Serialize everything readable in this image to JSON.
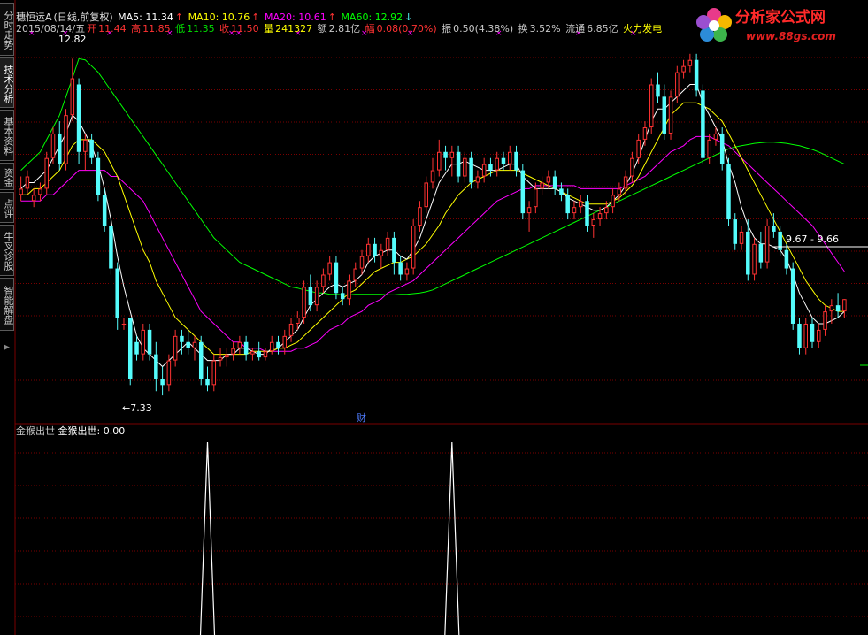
{
  "sidebar": {
    "tabs": [
      {
        "label": "分时走势",
        "active": false
      },
      {
        "label": "技术分析",
        "active": true
      },
      {
        "label": "基本资料",
        "active": false
      },
      {
        "label": "资金",
        "active": false
      },
      {
        "label": "点评",
        "active": false
      },
      {
        "label": "牛叉诊股",
        "active": false
      },
      {
        "label": "智能解盘",
        "active": false
      }
    ]
  },
  "header": {
    "name": "穗恒运A",
    "mode": "(日线,前复权)",
    "ma5_label": "MA5: 11.34",
    "ma5_arrow": "↑",
    "ma10_label": "MA10: 10.76",
    "ma10_arrow": "↑",
    "ma20_label": "MA20: 10.61",
    "ma20_arrow": "↑",
    "ma60_label": "MA60: 12.92",
    "ma60_arrow": "↓"
  },
  "quote": {
    "date": "2015/08/14/五",
    "open_label": "开",
    "open": "11.44",
    "high_label": "高",
    "high": "11.85",
    "low_label": "低",
    "low": "11.35",
    "close_label": "收",
    "close": "11.50",
    "volume_label": "量",
    "volume": "241327",
    "amount_label": "额",
    "amount": "2.81亿",
    "change_label": "幅",
    "change": "0.08(0.70%)",
    "amplitude_label": "振",
    "amplitude": "0.50(4.38%)",
    "turnover_label": "换",
    "turnover": "3.52%",
    "float_label": "流通",
    "float_value": "6.85亿",
    "signal": "火力发电"
  },
  "logo": {
    "title": "分析家公式网",
    "url": "www.88gs.com"
  },
  "annotations": {
    "high_mark": "12.82",
    "low_mark": "←7.33",
    "range_mark": "9.67 - 9.66",
    "event_badge": "财"
  },
  "indicator": {
    "name": "金猴出世",
    "label": "金猴出世:",
    "value": "0.00"
  },
  "colors": {
    "up": "#ff3232",
    "down": "#54fcfc",
    "ma5": "#ffffff",
    "ma10": "#ffff00",
    "ma20": "#ff00ff",
    "ma60": "#00ff00",
    "grid": "#7a0000"
  },
  "chart_data": {
    "type": "candlestick",
    "price_range": [
      7.0,
      13.2
    ],
    "candles": [
      {
        "o": 10.6,
        "h": 10.9,
        "l": 10.5,
        "c": 10.7
      },
      {
        "o": 10.7,
        "h": 11.0,
        "l": 10.6,
        "c": 10.9
      },
      {
        "o": 10.5,
        "h": 10.7,
        "l": 10.4,
        "c": 10.6
      },
      {
        "o": 10.6,
        "h": 10.8,
        "l": 10.5,
        "c": 10.7
      },
      {
        "o": 10.7,
        "h": 11.3,
        "l": 10.6,
        "c": 11.2
      },
      {
        "o": 11.2,
        "h": 11.7,
        "l": 11.1,
        "c": 11.6
      },
      {
        "o": 11.6,
        "h": 11.8,
        "l": 11.0,
        "c": 11.1
      },
      {
        "o": 11.1,
        "h": 12.0,
        "l": 11.0,
        "c": 11.9
      },
      {
        "o": 11.9,
        "h": 12.82,
        "l": 11.8,
        "c": 12.5
      },
      {
        "o": 12.4,
        "h": 12.5,
        "l": 11.1,
        "c": 11.3
      },
      {
        "o": 11.3,
        "h": 11.6,
        "l": 11.0,
        "c": 11.5
      },
      {
        "o": 11.5,
        "h": 11.6,
        "l": 11.1,
        "c": 11.2
      },
      {
        "o": 11.2,
        "h": 11.3,
        "l": 10.5,
        "c": 10.6
      },
      {
        "o": 10.6,
        "h": 10.7,
        "l": 10.0,
        "c": 10.1
      },
      {
        "o": 10.1,
        "h": 10.2,
        "l": 9.3,
        "c": 9.4
      },
      {
        "o": 9.4,
        "h": 9.5,
        "l": 8.4,
        "c": 8.6
      },
      {
        "o": 8.5,
        "h": 8.6,
        "l": 8.4,
        "c": 8.5
      },
      {
        "o": 8.6,
        "h": 8.6,
        "l": 7.5,
        "c": 7.6
      },
      {
        "o": 8.2,
        "h": 8.3,
        "l": 7.9,
        "c": 8.0
      },
      {
        "o": 8.0,
        "h": 8.5,
        "l": 7.9,
        "c": 8.4
      },
      {
        "o": 8.4,
        "h": 8.5,
        "l": 7.9,
        "c": 8.0
      },
      {
        "o": 8.0,
        "h": 8.2,
        "l": 7.4,
        "c": 7.6
      },
      {
        "o": 7.6,
        "h": 7.8,
        "l": 7.33,
        "c": 7.5
      },
      {
        "o": 7.5,
        "h": 8.0,
        "l": 7.4,
        "c": 7.9
      },
      {
        "o": 7.9,
        "h": 8.4,
        "l": 7.8,
        "c": 8.3
      },
      {
        "o": 8.3,
        "h": 8.4,
        "l": 8.0,
        "c": 8.2
      },
      {
        "o": 8.2,
        "h": 8.4,
        "l": 8.0,
        "c": 8.1
      },
      {
        "o": 8.1,
        "h": 8.3,
        "l": 7.9,
        "c": 8.2
      },
      {
        "o": 8.2,
        "h": 8.3,
        "l": 7.5,
        "c": 7.6
      },
      {
        "o": 7.6,
        "h": 7.8,
        "l": 7.4,
        "c": 7.5
      },
      {
        "o": 7.5,
        "h": 8.0,
        "l": 7.4,
        "c": 7.9
      },
      {
        "o": 7.9,
        "h": 8.1,
        "l": 7.8,
        "c": 7.95
      },
      {
        "o": 7.95,
        "h": 8.1,
        "l": 7.8,
        "c": 8.0
      },
      {
        "o": 8.0,
        "h": 8.2,
        "l": 7.9,
        "c": 8.1
      },
      {
        "o": 8.1,
        "h": 8.3,
        "l": 8.0,
        "c": 8.2
      },
      {
        "o": 8.2,
        "h": 8.3,
        "l": 7.9,
        "c": 8.0
      },
      {
        "o": 8.0,
        "h": 8.1,
        "l": 7.9,
        "c": 8.05
      },
      {
        "o": 8.05,
        "h": 8.2,
        "l": 7.9,
        "c": 7.95
      },
      {
        "o": 7.95,
        "h": 8.1,
        "l": 7.9,
        "c": 8.05
      },
      {
        "o": 8.05,
        "h": 8.3,
        "l": 8.0,
        "c": 8.2
      },
      {
        "o": 8.2,
        "h": 8.3,
        "l": 8.0,
        "c": 8.1
      },
      {
        "o": 8.1,
        "h": 8.4,
        "l": 8.0,
        "c": 8.3
      },
      {
        "o": 8.3,
        "h": 8.6,
        "l": 8.2,
        "c": 8.5
      },
      {
        "o": 8.5,
        "h": 8.7,
        "l": 8.4,
        "c": 8.6
      },
      {
        "o": 8.6,
        "h": 9.2,
        "l": 8.5,
        "c": 9.1
      },
      {
        "o": 9.1,
        "h": 9.3,
        "l": 8.7,
        "c": 8.8
      },
      {
        "o": 8.8,
        "h": 9.2,
        "l": 8.7,
        "c": 9.1
      },
      {
        "o": 9.1,
        "h": 9.4,
        "l": 9.0,
        "c": 9.3
      },
      {
        "o": 9.3,
        "h": 9.6,
        "l": 9.2,
        "c": 9.5
      },
      {
        "o": 9.5,
        "h": 9.6,
        "l": 8.9,
        "c": 9.0
      },
      {
        "o": 9.0,
        "h": 9.1,
        "l": 8.8,
        "c": 8.9
      },
      {
        "o": 8.9,
        "h": 9.3,
        "l": 8.8,
        "c": 9.2
      },
      {
        "o": 9.2,
        "h": 9.5,
        "l": 9.1,
        "c": 9.4
      },
      {
        "o": 9.4,
        "h": 9.7,
        "l": 9.3,
        "c": 9.6
      },
      {
        "o": 9.6,
        "h": 9.9,
        "l": 9.5,
        "c": 9.8
      },
      {
        "o": 9.8,
        "h": 9.9,
        "l": 9.5,
        "c": 9.6
      },
      {
        "o": 9.6,
        "h": 9.8,
        "l": 9.4,
        "c": 9.7
      },
      {
        "o": 9.7,
        "h": 10.0,
        "l": 9.6,
        "c": 9.9
      },
      {
        "o": 9.9,
        "h": 10.0,
        "l": 9.3,
        "c": 9.5
      },
      {
        "o": 9.5,
        "h": 9.6,
        "l": 9.2,
        "c": 9.3
      },
      {
        "o": 9.3,
        "h": 9.5,
        "l": 9.2,
        "c": 9.4
      },
      {
        "o": 9.4,
        "h": 10.2,
        "l": 9.3,
        "c": 10.1
      },
      {
        "o": 10.1,
        "h": 10.5,
        "l": 10.0,
        "c": 10.4
      },
      {
        "o": 10.4,
        "h": 10.9,
        "l": 10.3,
        "c": 10.8
      },
      {
        "o": 10.8,
        "h": 11.2,
        "l": 10.7,
        "c": 11.0
      },
      {
        "o": 11.0,
        "h": 11.5,
        "l": 10.9,
        "c": 11.3
      },
      {
        "o": 11.3,
        "h": 11.4,
        "l": 11.0,
        "c": 11.2
      },
      {
        "o": 11.2,
        "h": 11.4,
        "l": 10.9,
        "c": 11.3
      },
      {
        "o": 11.3,
        "h": 11.4,
        "l": 10.8,
        "c": 10.9
      },
      {
        "o": 10.9,
        "h": 11.3,
        "l": 10.8,
        "c": 11.2
      },
      {
        "o": 11.2,
        "h": 11.3,
        "l": 10.7,
        "c": 10.8
      },
      {
        "o": 10.8,
        "h": 11.0,
        "l": 10.7,
        "c": 10.9
      },
      {
        "o": 10.9,
        "h": 11.2,
        "l": 10.8,
        "c": 11.1
      },
      {
        "o": 11.1,
        "h": 11.2,
        "l": 10.9,
        "c": 11.0
      },
      {
        "o": 11.0,
        "h": 11.3,
        "l": 10.9,
        "c": 11.2
      },
      {
        "o": 11.2,
        "h": 11.3,
        "l": 11.0,
        "c": 11.1
      },
      {
        "o": 11.1,
        "h": 11.4,
        "l": 11.0,
        "c": 11.3
      },
      {
        "o": 11.3,
        "h": 11.4,
        "l": 10.9,
        "c": 11.0
      },
      {
        "o": 11.0,
        "h": 11.1,
        "l": 10.2,
        "c": 10.3
      },
      {
        "o": 10.3,
        "h": 10.5,
        "l": 10.0,
        "c": 10.4
      },
      {
        "o": 10.4,
        "h": 10.8,
        "l": 10.3,
        "c": 10.7
      },
      {
        "o": 10.7,
        "h": 10.9,
        "l": 10.6,
        "c": 10.8
      },
      {
        "o": 10.8,
        "h": 11.0,
        "l": 10.7,
        "c": 10.9
      },
      {
        "o": 10.9,
        "h": 11.0,
        "l": 10.6,
        "c": 10.7
      },
      {
        "o": 10.7,
        "h": 10.8,
        "l": 10.5,
        "c": 10.6
      },
      {
        "o": 10.6,
        "h": 10.7,
        "l": 10.2,
        "c": 10.3
      },
      {
        "o": 10.3,
        "h": 10.5,
        "l": 10.2,
        "c": 10.4
      },
      {
        "o": 10.4,
        "h": 10.6,
        "l": 10.3,
        "c": 10.5
      },
      {
        "o": 10.5,
        "h": 10.6,
        "l": 10.0,
        "c": 10.1
      },
      {
        "o": 10.1,
        "h": 10.3,
        "l": 9.9,
        "c": 10.2
      },
      {
        "o": 10.2,
        "h": 10.4,
        "l": 10.1,
        "c": 10.3
      },
      {
        "o": 10.3,
        "h": 10.5,
        "l": 10.2,
        "c": 10.4
      },
      {
        "o": 10.4,
        "h": 10.7,
        "l": 10.3,
        "c": 10.6
      },
      {
        "o": 10.6,
        "h": 10.8,
        "l": 10.5,
        "c": 10.7
      },
      {
        "o": 10.7,
        "h": 11.0,
        "l": 10.6,
        "c": 10.9
      },
      {
        "o": 10.9,
        "h": 11.3,
        "l": 10.8,
        "c": 11.2
      },
      {
        "o": 11.2,
        "h": 11.6,
        "l": 11.1,
        "c": 11.5
      },
      {
        "o": 11.5,
        "h": 11.8,
        "l": 11.4,
        "c": 11.7
      },
      {
        "o": 11.7,
        "h": 12.5,
        "l": 11.6,
        "c": 12.4
      },
      {
        "o": 12.4,
        "h": 12.6,
        "l": 12.1,
        "c": 12.2
      },
      {
        "o": 12.2,
        "h": 12.4,
        "l": 11.5,
        "c": 11.6
      },
      {
        "o": 11.6,
        "h": 12.3,
        "l": 11.5,
        "c": 12.2
      },
      {
        "o": 12.2,
        "h": 12.7,
        "l": 12.1,
        "c": 12.6
      },
      {
        "o": 12.6,
        "h": 12.8,
        "l": 12.5,
        "c": 12.7
      },
      {
        "o": 12.7,
        "h": 12.9,
        "l": 12.6,
        "c": 12.8
      },
      {
        "o": 12.8,
        "h": 12.9,
        "l": 12.2,
        "c": 12.3
      },
      {
        "o": 12.3,
        "h": 12.4,
        "l": 11.1,
        "c": 11.2
      },
      {
        "o": 11.2,
        "h": 11.6,
        "l": 11.1,
        "c": 11.5
      },
      {
        "o": 11.5,
        "h": 11.7,
        "l": 11.4,
        "c": 11.6
      },
      {
        "o": 11.6,
        "h": 11.7,
        "l": 11.0,
        "c": 11.1
      },
      {
        "o": 11.1,
        "h": 11.2,
        "l": 10.1,
        "c": 10.2
      },
      {
        "o": 10.2,
        "h": 10.3,
        "l": 9.7,
        "c": 9.8
      },
      {
        "o": 9.8,
        "h": 10.1,
        "l": 9.7,
        "c": 10.0
      },
      {
        "o": 10.0,
        "h": 10.2,
        "l": 9.2,
        "c": 9.3
      },
      {
        "o": 9.3,
        "h": 9.9,
        "l": 9.2,
        "c": 9.8
      },
      {
        "o": 9.8,
        "h": 10.0,
        "l": 9.4,
        "c": 9.5
      },
      {
        "o": 9.5,
        "h": 10.2,
        "l": 9.4,
        "c": 10.1
      },
      {
        "o": 10.1,
        "h": 10.3,
        "l": 9.9,
        "c": 10.0
      },
      {
        "o": 10.0,
        "h": 10.1,
        "l": 9.6,
        "c": 9.7
      },
      {
        "o": 9.7,
        "h": 9.8,
        "l": 9.3,
        "c": 9.4
      },
      {
        "o": 9.4,
        "h": 9.5,
        "l": 8.4,
        "c": 8.5
      },
      {
        "o": 8.5,
        "h": 8.6,
        "l": 8.0,
        "c": 8.1
      },
      {
        "o": 8.1,
        "h": 8.6,
        "l": 8.0,
        "c": 8.5
      },
      {
        "o": 8.5,
        "h": 8.6,
        "l": 8.1,
        "c": 8.2
      },
      {
        "o": 8.2,
        "h": 8.5,
        "l": 8.1,
        "c": 8.4
      },
      {
        "o": 8.4,
        "h": 8.8,
        "l": 8.3,
        "c": 8.7
      },
      {
        "o": 8.7,
        "h": 8.9,
        "l": 8.5,
        "c": 8.8
      },
      {
        "o": 8.8,
        "h": 9.0,
        "l": 8.6,
        "c": 8.7
      },
      {
        "o": 8.7,
        "h": 8.9,
        "l": 8.6,
        "c": 8.9
      }
    ],
    "ma5": [
      10.7,
      10.8,
      10.8,
      10.9,
      11.0,
      11.2,
      11.4,
      11.6,
      11.9,
      11.8,
      11.6,
      11.4,
      11.1,
      10.7,
      10.2,
      9.6,
      9.1,
      8.7,
      8.3,
      8.1,
      8.0,
      7.9,
      7.8,
      7.9,
      8.0,
      8.1,
      8.2,
      8.1,
      8.0,
      7.9,
      7.9,
      7.9,
      8.0,
      8.0,
      8.1,
      8.1,
      8.05,
      8.0,
      8.0,
      8.1,
      8.1,
      8.2,
      8.3,
      8.4,
      8.6,
      8.8,
      8.9,
      9.0,
      9.1,
      9.15,
      9.1,
      9.15,
      9.2,
      9.3,
      9.5,
      9.6,
      9.65,
      9.7,
      9.7,
      9.6,
      9.55,
      9.7,
      9.9,
      10.2,
      10.5,
      10.8,
      10.95,
      11.1,
      11.1,
      11.15,
      11.1,
      11.05,
      11.0,
      11.0,
      11.0,
      11.05,
      11.1,
      11.1,
      10.9,
      10.8,
      10.7,
      10.7,
      10.7,
      10.7,
      10.65,
      10.55,
      10.5,
      10.45,
      10.4,
      10.35,
      10.35,
      10.4,
      10.5,
      10.6,
      10.75,
      10.95,
      11.2,
      11.5,
      11.8,
      12.0,
      12.0,
      12.1,
      12.2,
      12.3,
      12.4,
      12.4,
      12.1,
      11.9,
      11.7,
      11.5,
      11.1,
      10.8,
      10.4,
      10.1,
      9.9,
      9.8,
      9.8,
      9.75,
      9.7,
      9.55,
      9.3,
      9.0,
      8.8,
      8.6,
      8.5,
      8.5,
      8.55,
      8.6,
      8.7
    ],
    "ma10": [
      10.6,
      10.6,
      10.7,
      10.7,
      10.8,
      10.9,
      11.0,
      11.2,
      11.4,
      11.5,
      11.5,
      11.5,
      11.4,
      11.3,
      11.1,
      10.9,
      10.6,
      10.3,
      10.0,
      9.7,
      9.5,
      9.2,
      9.0,
      8.8,
      8.6,
      8.5,
      8.4,
      8.3,
      8.2,
      8.1,
      8.0,
      8.0,
      8.0,
      8.0,
      8.0,
      8.0,
      8.05,
      8.05,
      8.05,
      8.05,
      8.1,
      8.1,
      8.15,
      8.2,
      8.3,
      8.4,
      8.5,
      8.6,
      8.7,
      8.8,
      8.9,
      9.0,
      9.05,
      9.15,
      9.25,
      9.35,
      9.4,
      9.45,
      9.5,
      9.5,
      9.55,
      9.6,
      9.7,
      9.8,
      9.95,
      10.1,
      10.3,
      10.45,
      10.6,
      10.7,
      10.8,
      10.85,
      10.9,
      10.95,
      11.0,
      11.0,
      11.0,
      11.0,
      10.95,
      10.9,
      10.85,
      10.8,
      10.75,
      10.7,
      10.65,
      10.6,
      10.55,
      10.5,
      10.45,
      10.45,
      10.45,
      10.45,
      10.5,
      10.55,
      10.65,
      10.75,
      10.9,
      11.1,
      11.3,
      11.5,
      11.7,
      11.9,
      12.0,
      12.1,
      12.1,
      12.1,
      12.05,
      12.0,
      11.9,
      11.8,
      11.6,
      11.4,
      11.2,
      11.0,
      10.8,
      10.6,
      10.4,
      10.2,
      10.0,
      9.8,
      9.6,
      9.4,
      9.2,
      9.05,
      8.9,
      8.8,
      8.75,
      8.7,
      8.7
    ],
    "ma20": [
      10.5,
      10.5,
      10.5,
      10.5,
      10.6,
      10.6,
      10.7,
      10.8,
      10.9,
      11.0,
      11.0,
      11.0,
      11.0,
      11.0,
      10.9,
      10.9,
      10.8,
      10.7,
      10.6,
      10.5,
      10.3,
      10.1,
      9.9,
      9.7,
      9.5,
      9.3,
      9.1,
      8.9,
      8.7,
      8.6,
      8.5,
      8.4,
      8.3,
      8.2,
      8.2,
      8.1,
      8.1,
      8.1,
      8.05,
      8.05,
      8.05,
      8.05,
      8.05,
      8.1,
      8.1,
      8.15,
      8.2,
      8.3,
      8.4,
      8.45,
      8.5,
      8.6,
      8.65,
      8.7,
      8.8,
      8.85,
      8.9,
      9.0,
      9.05,
      9.1,
      9.15,
      9.2,
      9.3,
      9.4,
      9.5,
      9.6,
      9.7,
      9.8,
      9.9,
      10.0,
      10.1,
      10.2,
      10.3,
      10.4,
      10.5,
      10.55,
      10.6,
      10.65,
      10.7,
      10.7,
      10.75,
      10.75,
      10.75,
      10.75,
      10.75,
      10.75,
      10.75,
      10.7,
      10.7,
      10.7,
      10.7,
      10.7,
      10.7,
      10.7,
      10.75,
      10.8,
      10.85,
      10.9,
      11.0,
      11.1,
      11.2,
      11.3,
      11.35,
      11.4,
      11.5,
      11.55,
      11.55,
      11.55,
      11.5,
      11.45,
      11.4,
      11.3,
      11.2,
      11.1,
      11.0,
      10.9,
      10.8,
      10.7,
      10.6,
      10.5,
      10.4,
      10.3,
      10.2,
      10.1,
      9.95,
      9.8,
      9.65,
      9.5,
      9.35
    ],
    "ma60": [
      11.0,
      11.1,
      11.2,
      11.3,
      11.5,
      11.7,
      11.9,
      12.2,
      12.5,
      12.82,
      12.8,
      12.7,
      12.6,
      12.45,
      12.3,
      12.15,
      12.0,
      11.85,
      11.7,
      11.55,
      11.4,
      11.25,
      11.1,
      10.95,
      10.8,
      10.65,
      10.5,
      10.35,
      10.2,
      10.05,
      9.9,
      9.8,
      9.7,
      9.6,
      9.5,
      9.45,
      9.4,
      9.35,
      9.3,
      9.25,
      9.2,
      9.15,
      9.1,
      9.08,
      9.05,
      9.03,
      9.0,
      9.0,
      8.98,
      8.98,
      8.97,
      8.97,
      8.98,
      8.98,
      8.98,
      8.98,
      8.98,
      8.97,
      8.97,
      8.98,
      8.98,
      8.99,
      9.0,
      9.02,
      9.05,
      9.1,
      9.15,
      9.2,
      9.25,
      9.3,
      9.35,
      9.4,
      9.45,
      9.5,
      9.55,
      9.6,
      9.65,
      9.7,
      9.75,
      9.8,
      9.85,
      9.9,
      9.95,
      10.0,
      10.05,
      10.1,
      10.15,
      10.2,
      10.25,
      10.3,
      10.35,
      10.4,
      10.45,
      10.5,
      10.55,
      10.6,
      10.65,
      10.7,
      10.75,
      10.8,
      10.85,
      10.9,
      10.95,
      11.0,
      11.05,
      11.1,
      11.15,
      11.2,
      11.25,
      11.3,
      11.35,
      11.38,
      11.4,
      11.42,
      11.44,
      11.45,
      11.46,
      11.46,
      11.45,
      11.44,
      11.42,
      11.4,
      11.37,
      11.34,
      11.3,
      11.25,
      11.2,
      11.15,
      11.1
    ],
    "signal_bars": [
      29,
      67,
      151
    ],
    "signal_range": [
      0,
      1
    ]
  }
}
